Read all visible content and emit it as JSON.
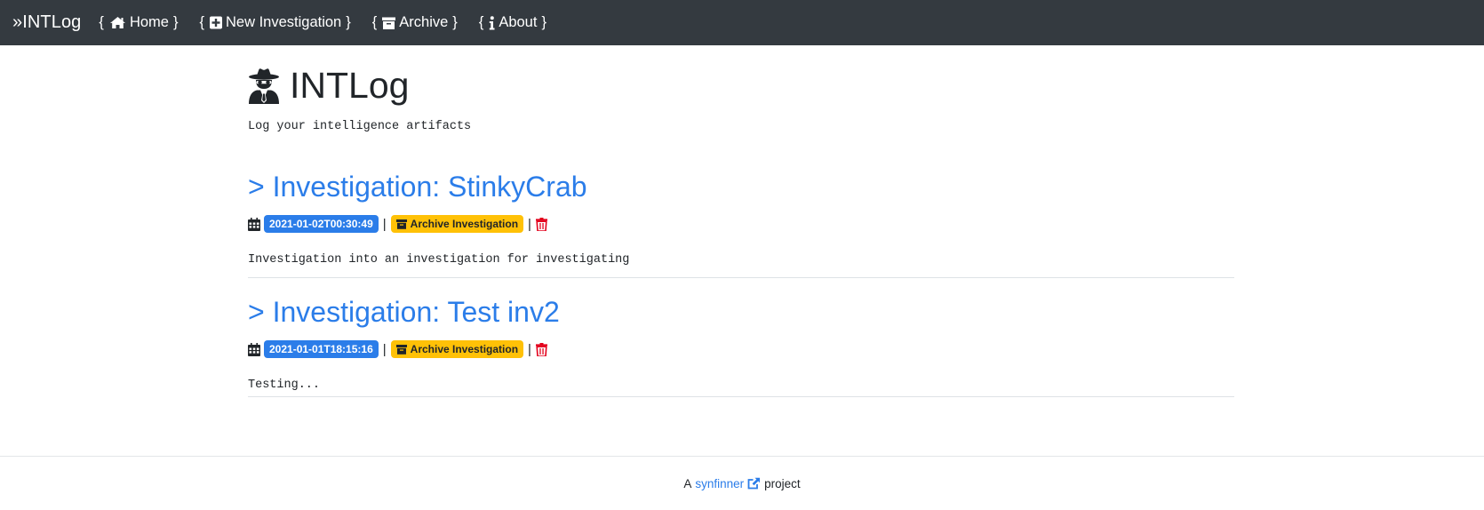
{
  "nav": {
    "brand": "»INTLog",
    "items": [
      {
        "label": "Home",
        "icon": "home-icon"
      },
      {
        "label": "New Investigation",
        "icon": "plus-square-icon"
      },
      {
        "label": "Archive",
        "icon": "archive-icon"
      },
      {
        "label": "About",
        "icon": "info-icon"
      }
    ],
    "open_brace": "{",
    "close_brace": "}"
  },
  "hero": {
    "icon": "user-secret-icon",
    "title": "INTLog",
    "tagline": "Log your intelligence artifacts"
  },
  "investigations": [
    {
      "title": "> Investigation: StinkyCrab",
      "date": "2021-01-02T00:30:49",
      "archive_label": "Archive Investigation",
      "description": "Investigation into an investigation for investigating"
    },
    {
      "title": "> Investigation: Test inv2",
      "date": "2021-01-01T18:15:16",
      "archive_label": "Archive Investigation",
      "description": "Testing..."
    }
  ],
  "separator": "|",
  "footer": {
    "prefix": "A",
    "link": "synfinner",
    "suffix": "project",
    "link_icon": "external-link-icon"
  },
  "colors": {
    "navbar": "#343a40",
    "primary": "#2b7de9",
    "warning": "#ffc107",
    "danger": "#e3001b"
  }
}
